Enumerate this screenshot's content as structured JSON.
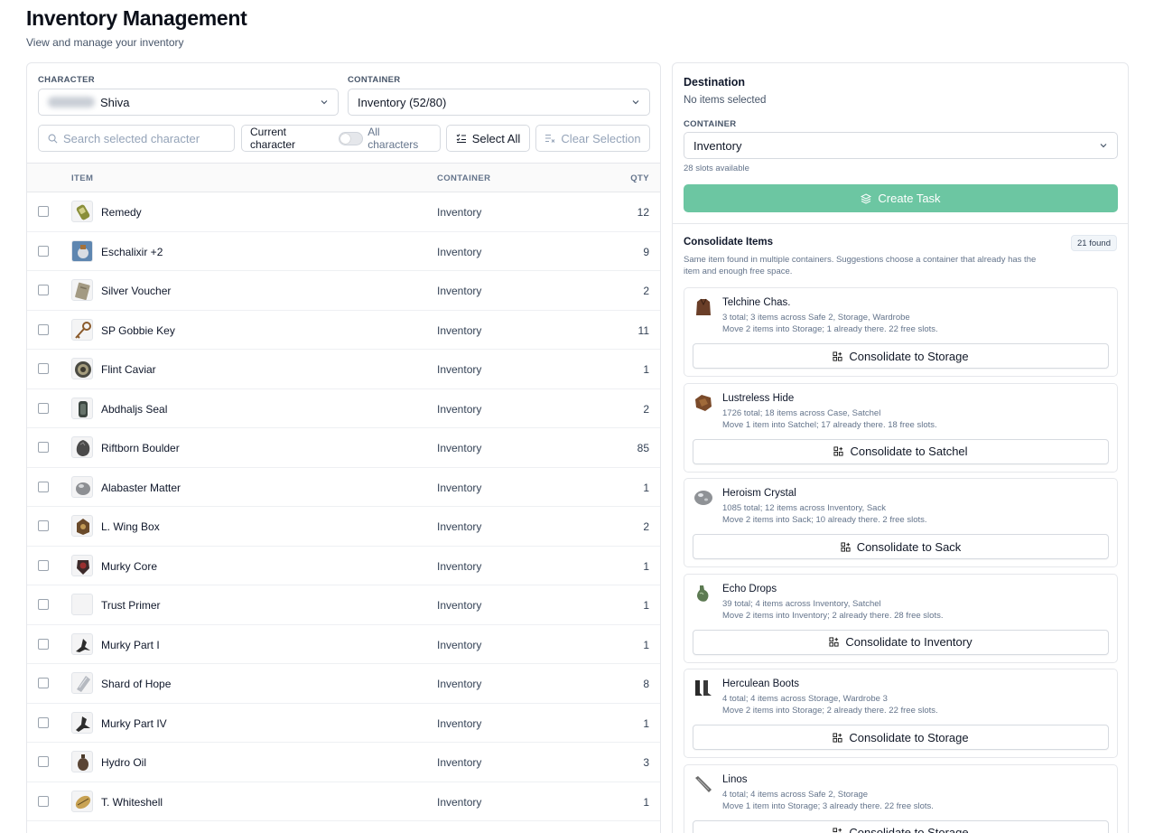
{
  "page": {
    "title": "Inventory Management",
    "subtitle": "View and manage your inventory"
  },
  "filters": {
    "character_label": "CHARACTER",
    "character_value": "Shiva",
    "container_label": "CONTAINER",
    "container_value": "Inventory (52/80)",
    "search_placeholder": "Search selected character",
    "toggle_current": "Current character",
    "toggle_all": "All characters",
    "select_all": "Select All",
    "clear_selection": "Clear Selection"
  },
  "table": {
    "headers": {
      "item": "ITEM",
      "container": "CONTAINER",
      "qty": "QTY"
    },
    "rows": [
      {
        "name": "Remedy",
        "container": "Inventory",
        "qty": "12"
      },
      {
        "name": "Eschalixir +2",
        "container": "Inventory",
        "qty": "9"
      },
      {
        "name": "Silver Voucher",
        "container": "Inventory",
        "qty": "2"
      },
      {
        "name": "SP Gobbie Key",
        "container": "Inventory",
        "qty": "11"
      },
      {
        "name": "Flint Caviar",
        "container": "Inventory",
        "qty": "1"
      },
      {
        "name": "Abdhaljs Seal",
        "container": "Inventory",
        "qty": "2"
      },
      {
        "name": "Riftborn Boulder",
        "container": "Inventory",
        "qty": "85"
      },
      {
        "name": "Alabaster Matter",
        "container": "Inventory",
        "qty": "1"
      },
      {
        "name": "L. Wing Box",
        "container": "Inventory",
        "qty": "2"
      },
      {
        "name": "Murky Core",
        "container": "Inventory",
        "qty": "1"
      },
      {
        "name": "Trust Primer",
        "container": "Inventory",
        "qty": "1"
      },
      {
        "name": "Murky Part I",
        "container": "Inventory",
        "qty": "1"
      },
      {
        "name": "Shard of Hope",
        "container": "Inventory",
        "qty": "8"
      },
      {
        "name": "Murky Part IV",
        "container": "Inventory",
        "qty": "1"
      },
      {
        "name": "Hydro Oil",
        "container": "Inventory",
        "qty": "3"
      },
      {
        "name": "T. Whiteshell",
        "container": "Inventory",
        "qty": "1"
      }
    ]
  },
  "destination": {
    "title": "Destination",
    "subtitle": "No items selected",
    "container_label": "CONTAINER",
    "container_value": "Inventory",
    "slots_text": "28 slots available",
    "create_task": "Create Task",
    "accent_color": "#6cc6a2"
  },
  "consolidate": {
    "title": "Consolidate Items",
    "badge": "21 found",
    "description": "Same item found in multiple containers. Suggestions choose a container that already has the item and enough free space.",
    "cards": [
      {
        "name": "Telchine Chas.",
        "line1": "3 total; 3 items across Safe 2, Storage, Wardrobe",
        "line2": "Move 2 items into Storage; 1 already there. 22 free slots.",
        "button": "Consolidate to Storage"
      },
      {
        "name": "Lustreless Hide",
        "line1": "1726 total; 18 items across Case, Satchel",
        "line2": "Move 1 item into Satchel; 17 already there. 18 free slots.",
        "button": "Consolidate to Satchel"
      },
      {
        "name": "Heroism Crystal",
        "line1": "1085 total; 12 items across Inventory, Sack",
        "line2": "Move 2 items into Sack; 10 already there. 2 free slots.",
        "button": "Consolidate to Sack"
      },
      {
        "name": "Echo Drops",
        "line1": "39 total; 4 items across Inventory, Satchel",
        "line2": "Move 2 items into Inventory; 2 already there. 28 free slots.",
        "button": "Consolidate to Inventory"
      },
      {
        "name": "Herculean Boots",
        "line1": "4 total; 4 items across Storage, Wardrobe 3",
        "line2": "Move 2 items into Storage; 2 already there. 22 free slots.",
        "button": "Consolidate to Storage"
      },
      {
        "name": "Linos",
        "line1": "4 total; 4 items across Safe 2, Storage",
        "line2": "Move 1 item into Storage; 3 already there. 22 free slots.",
        "button": "Consolidate to Storage"
      }
    ]
  },
  "icons": {
    "search": "search-icon",
    "chevron": "chevron-down-icon",
    "select_all": "list-checks-icon",
    "clear": "list-x-icon",
    "create": "layers-icon",
    "consolidate": "merge-icon"
  }
}
